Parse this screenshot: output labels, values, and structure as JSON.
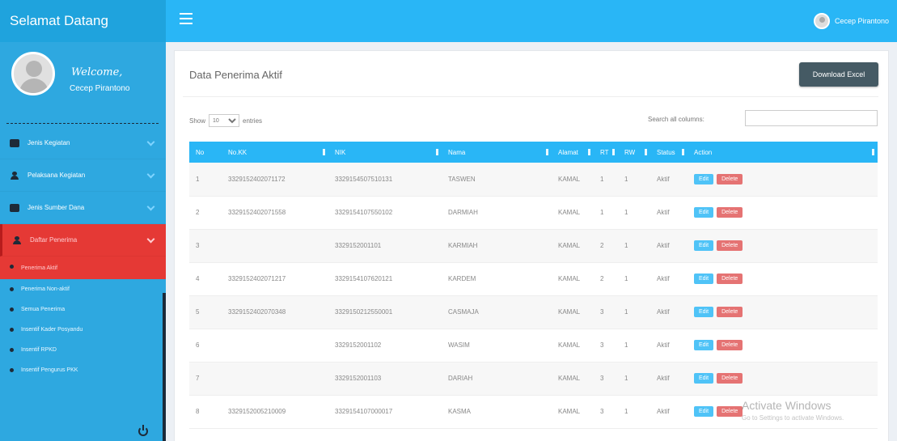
{
  "app": {
    "brand": "Selamat Datang",
    "user_top": "Cecep Pirantono"
  },
  "sidebar": {
    "welcome": "Welcome,",
    "user_name": "Cecep Pirantono",
    "items": [
      {
        "label": "Jenis Kegiatan",
        "icon": "database-icon"
      },
      {
        "label": "Pelaksana Kegiatan",
        "icon": "user-icon"
      },
      {
        "label": "Jenis Sumber Dana",
        "icon": "database-icon"
      },
      {
        "label": "Daftar Penerima",
        "icon": "user-icon",
        "active": true
      }
    ],
    "subitems": [
      {
        "label": "Penerima Aktif",
        "active": true
      },
      {
        "label": "Penerima Non-aktif"
      },
      {
        "label": "Semua Penerima"
      },
      {
        "label": "Insentif Kader Posyandu"
      },
      {
        "label": "Insentif RPKD"
      },
      {
        "label": "Insentif Pengurus PKK"
      }
    ]
  },
  "main": {
    "title": "Data Penerima Aktif",
    "download_label": "Download Excel",
    "show_label": "Show",
    "show_value": "10",
    "entries_label": "entries",
    "search_label": "Search all columns:",
    "search_value": "",
    "columns": [
      "No",
      "No.KK",
      "NIK",
      "Nama",
      "Alamat",
      "RT",
      "RW",
      "Status",
      "Action"
    ],
    "edit_label": "Edit",
    "delete_label": "Delete",
    "rows": [
      [
        "1",
        "3329152402071172",
        "3329154507510131",
        "TASWEN",
        "KAMAL",
        "1",
        "1",
        "Aktif"
      ],
      [
        "2",
        "3329152402071558",
        "3329154107550102",
        "DARMIAH",
        "KAMAL",
        "1",
        "1",
        "Aktif"
      ],
      [
        "3",
        "",
        "3329152001101",
        "KARMIAH",
        "KAMAL",
        "2",
        "1",
        "Aktif"
      ],
      [
        "4",
        "3329152402071217",
        "3329154107620121",
        "KARDEM",
        "KAMAL",
        "2",
        "1",
        "Aktif"
      ],
      [
        "5",
        "3329152402070348",
        "3329150212550001",
        "CASMAJA",
        "KAMAL",
        "3",
        "1",
        "Aktif"
      ],
      [
        "6",
        "",
        "3329152001102",
        "WASIM",
        "KAMAL",
        "3",
        "1",
        "Aktif"
      ],
      [
        "7",
        "",
        "3329152001103",
        "DARIAH",
        "KAMAL",
        "3",
        "1",
        "Aktif"
      ],
      [
        "8",
        "3329152005210009",
        "3329154107000017",
        "KASMA",
        "KAMAL",
        "3",
        "1",
        "Aktif"
      ]
    ]
  },
  "watermark": {
    "title": "Activate Windows",
    "subtitle": "Go to Settings to activate Windows."
  },
  "colors": {
    "topbar": "#29b6f6",
    "sidebar": "#2ea8e0",
    "active": "#e53935",
    "excel_button": "#455a64"
  }
}
